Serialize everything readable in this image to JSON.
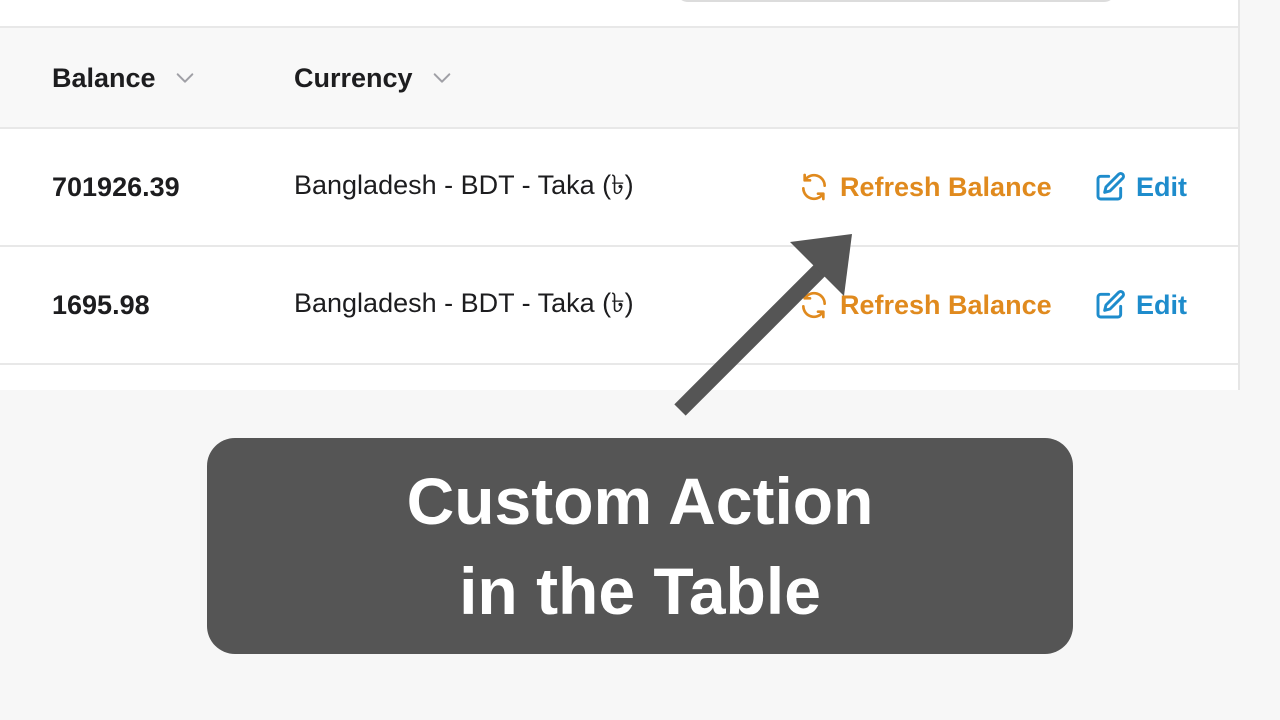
{
  "table": {
    "columns": [
      {
        "label": "Balance"
      },
      {
        "label": "Currency"
      }
    ],
    "rows": [
      {
        "balance": "701926.39",
        "currency": "Bangladesh - BDT - Taka (৳)",
        "actions": {
          "refresh": "Refresh Balance",
          "edit": "Edit"
        }
      },
      {
        "balance": "1695.98",
        "currency": "Bangladesh - BDT - Taka (৳)",
        "actions": {
          "refresh": "Refresh Balance",
          "edit": "Edit"
        }
      }
    ]
  },
  "caption": {
    "line1": "Custom Action",
    "line2": "in the Table"
  },
  "colors": {
    "refresh_action": "#e08a1e",
    "edit_action": "#1e8ccc",
    "caption_bg": "#555555",
    "arrow": "#555555"
  },
  "icons": {
    "sort": "chevron-down-icon",
    "refresh": "refresh-icon",
    "edit": "edit-icon",
    "annotation": "arrow-icon"
  }
}
